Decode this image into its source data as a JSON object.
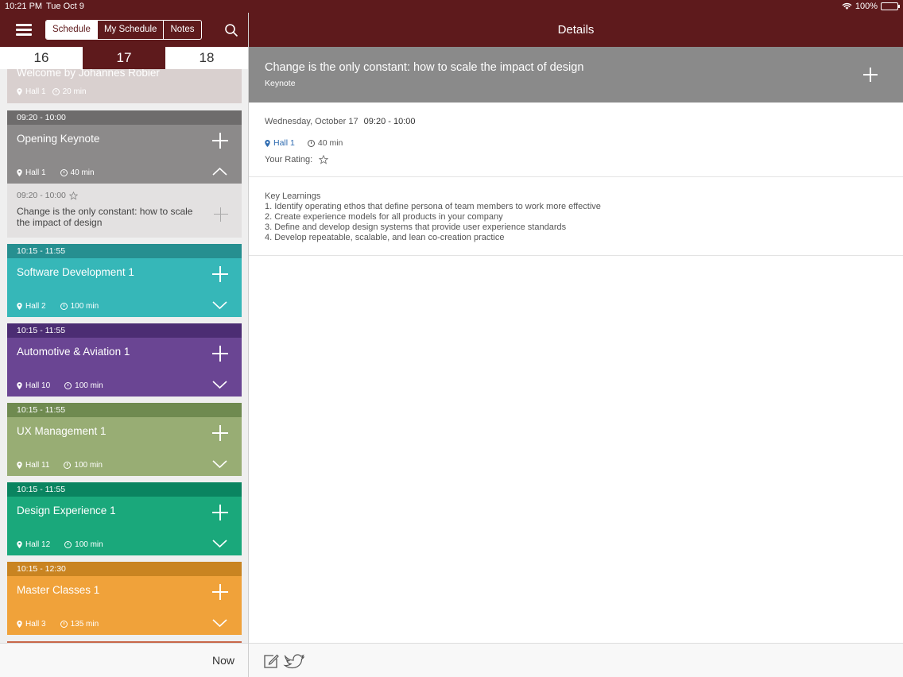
{
  "status_bar": {
    "time": "10:21 PM",
    "date": "Tue Oct 9",
    "battery": "100%"
  },
  "toolbar": {
    "segments": [
      "Schedule",
      "My Schedule",
      "Notes"
    ],
    "selected_segment": "Schedule"
  },
  "days": {
    "tabs": [
      "16",
      "17",
      "18"
    ],
    "selected": "17"
  },
  "sessions": {
    "welcome": {
      "title": "Welcome by Johannes Robier",
      "hall": "Hall 1",
      "duration": "20 min",
      "color": "#d9d0cf"
    },
    "opening": {
      "time": "09:20 - 10:00",
      "title": "Opening Keynote",
      "hall": "Hall 1",
      "duration": "40 min",
      "header_color": "#6e6c6c",
      "color": "#8c8a8a"
    },
    "opening_sub": {
      "time": "09:20 - 10:00",
      "title": "Change is the only constant: how to scale the impact of design"
    },
    "software": {
      "time": "10:15 - 11:55",
      "title": "Software Development 1",
      "hall": "Hall 2",
      "duration": "100 min",
      "header_color": "#268f90",
      "color": "#36b7b8"
    },
    "automotive": {
      "time": "10:15 - 11:55",
      "title": "Automotive & Aviation 1",
      "hall": "Hall 10",
      "duration": "100 min",
      "header_color": "#4c2d73",
      "color": "#6a4593"
    },
    "ux": {
      "time": "10:15 - 11:55",
      "title": "UX Management 1",
      "hall": "Hall 11",
      "duration": "100 min",
      "header_color": "#6f8a50",
      "color": "#98ad74"
    },
    "design": {
      "time": "10:15 - 11:55",
      "title": "Design Experience 1",
      "hall": "Hall 12",
      "duration": "100 min",
      "header_color": "#0a8460",
      "color": "#1aa87b"
    },
    "master": {
      "time": "10:15 - 12:30",
      "title": "Master Classes 1",
      "hall": "Hall 3",
      "duration": "135 min",
      "header_color": "#c98421",
      "color": "#f0a23a"
    }
  },
  "footer": {
    "now_label": "Now"
  },
  "details": {
    "header_title": "Details",
    "title": "Change is the only constant: how to scale the impact of design",
    "type": "Keynote",
    "date": "Wednesday, October 17",
    "time": "09:20 - 10:00",
    "hall": "Hall 1",
    "duration": "40 min",
    "rating_label": "Your Rating:",
    "description": [
      "Key Learnings",
      "1. Identify operating ethos that define persona of team members to work more effective",
      "2. Create experience models for all products in your company",
      "3. Define and develop design systems that provide user experience standards",
      "4. Develop repeatable, scalable, and lean co-creation practice"
    ]
  },
  "icons": [
    "menu-icon",
    "search-icon",
    "map-pin-icon",
    "clock-icon",
    "plus-icon",
    "chevron-down-icon",
    "chevron-up-icon",
    "star-outline-icon",
    "compose-icon",
    "twitter-bird-icon"
  ],
  "colors": {
    "brand": "#5e1a1c",
    "link": "#2e6bb0"
  }
}
